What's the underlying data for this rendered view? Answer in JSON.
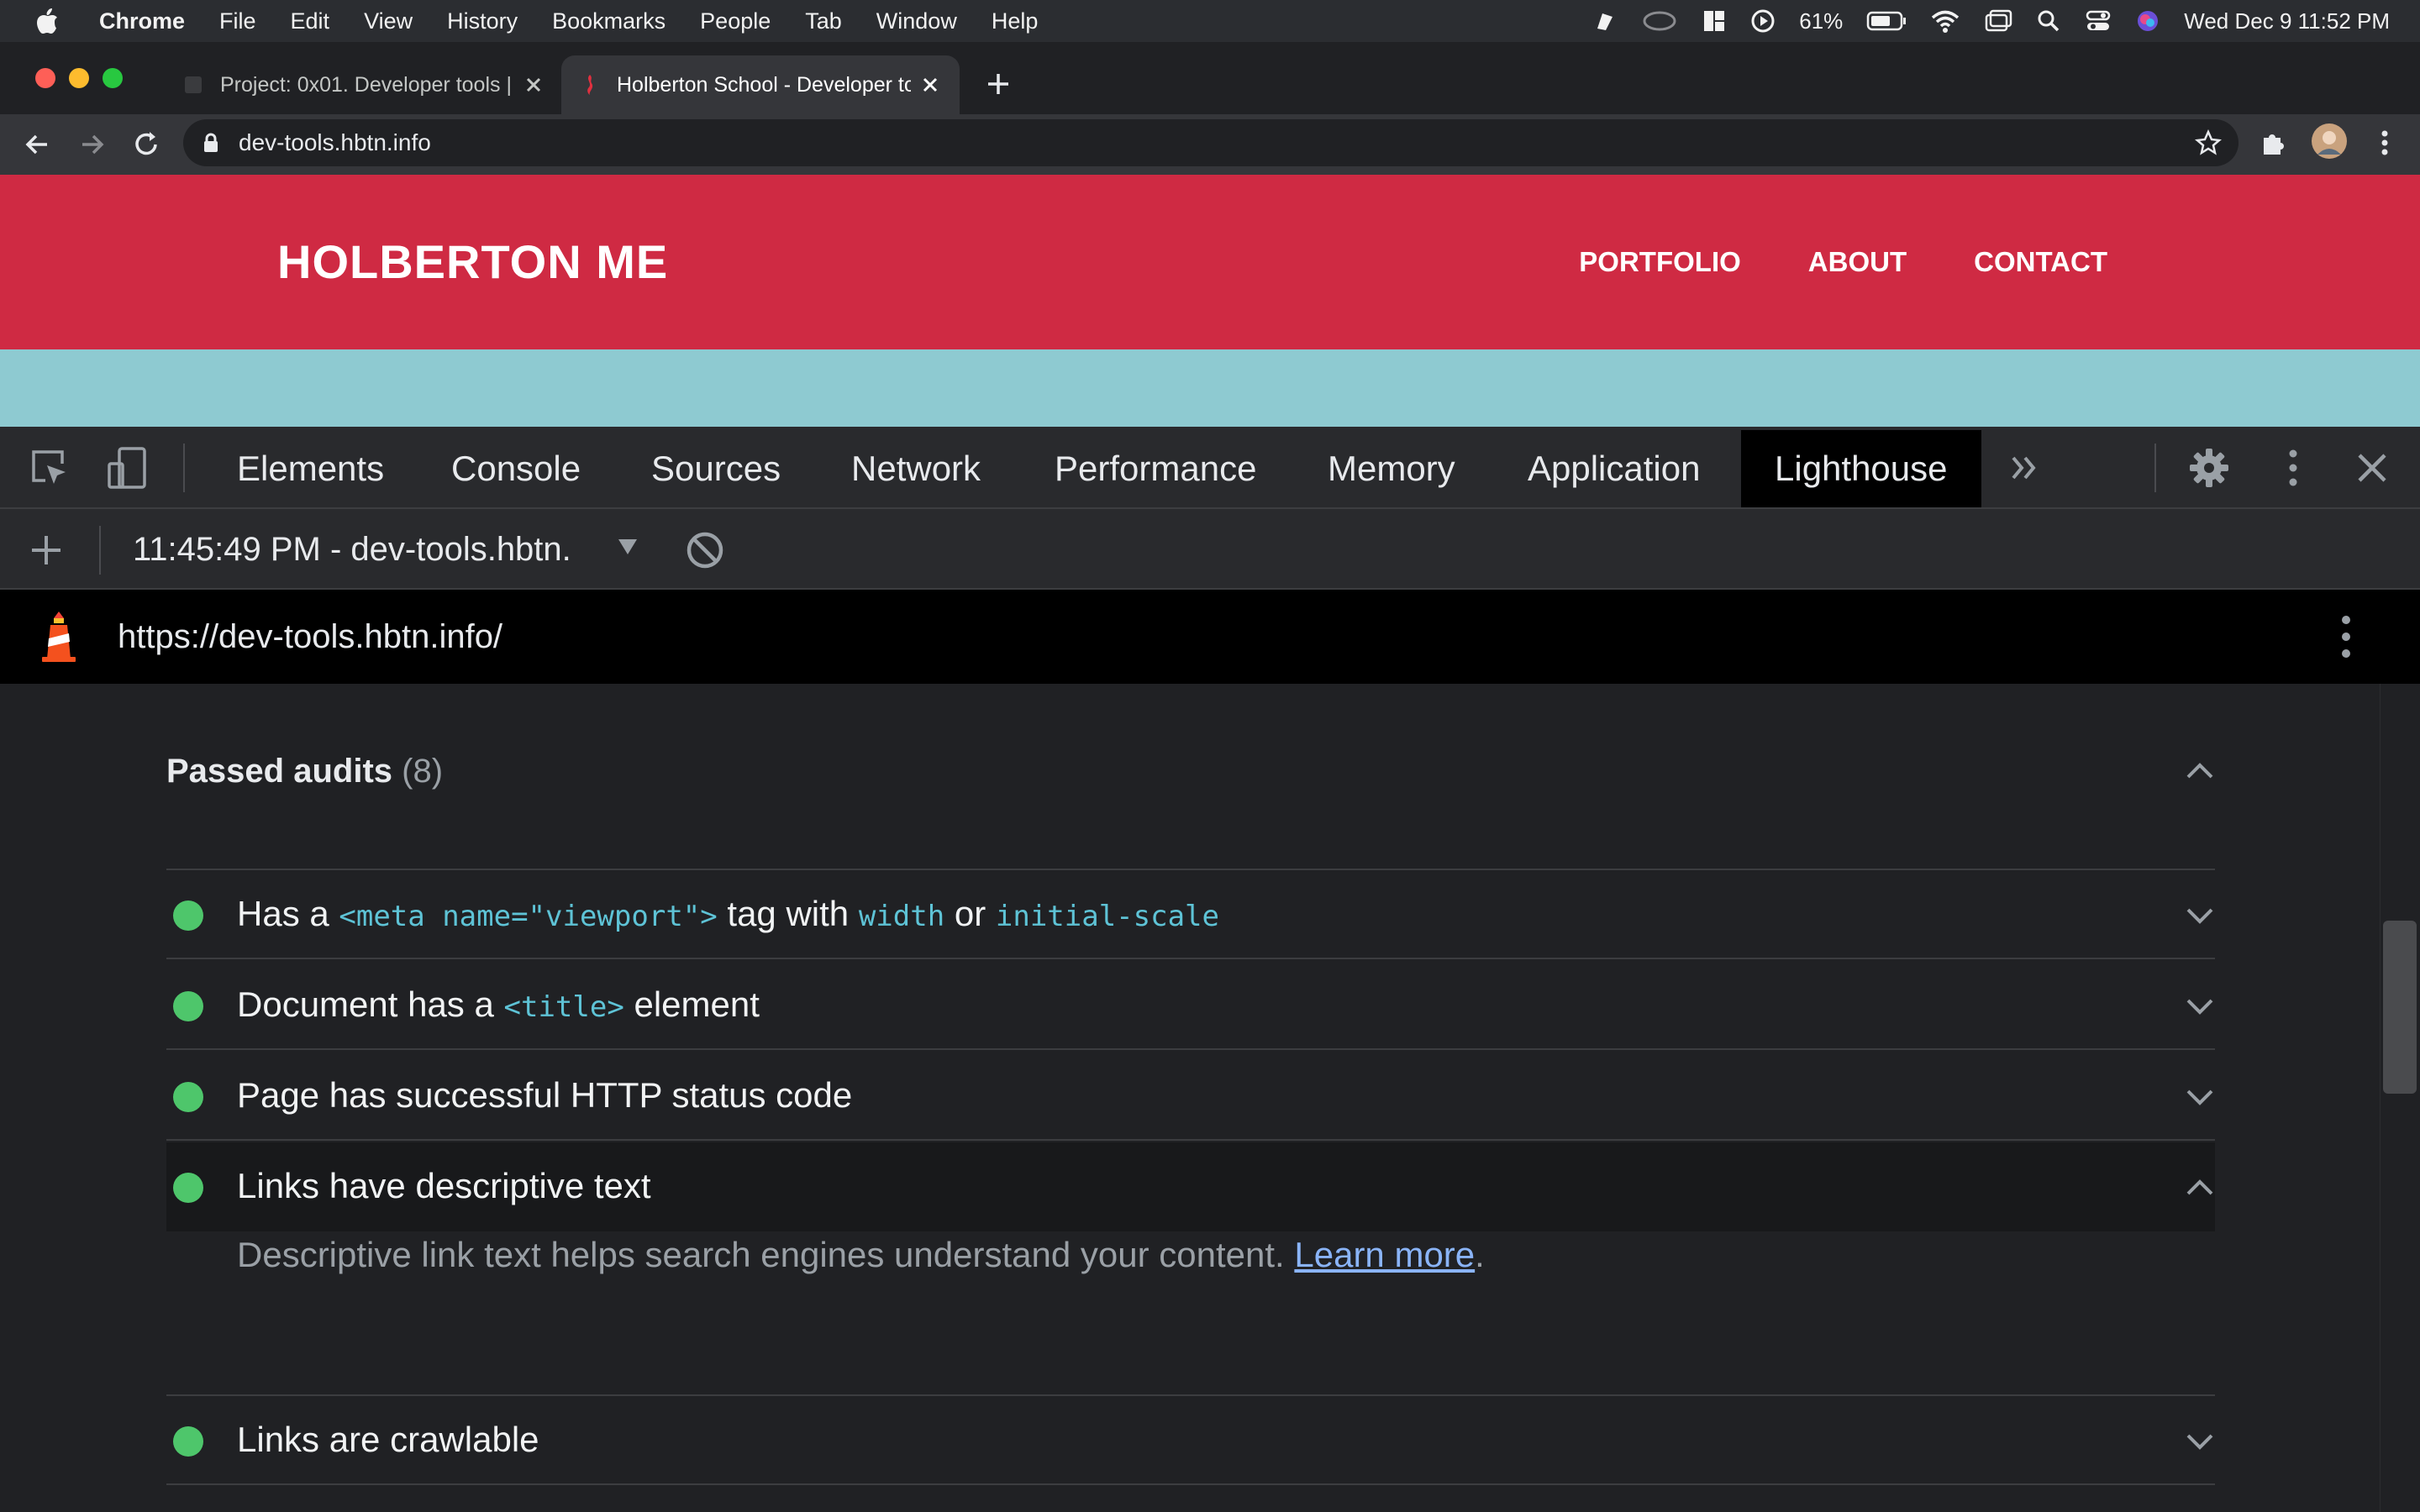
{
  "menubar": {
    "app_name": "Chrome",
    "items": [
      "File",
      "Edit",
      "View",
      "History",
      "Bookmarks",
      "People",
      "Tab",
      "Window",
      "Help"
    ],
    "battery": "61%",
    "datetime": "Wed Dec 9  11:52 PM"
  },
  "browser": {
    "tabs": [
      {
        "title": "Project: 0x01. Developer tools | I"
      },
      {
        "title": "Holberton School - Developer to"
      }
    ],
    "url": "dev-tools.hbtn.info"
  },
  "site": {
    "logo": "HOLBERTON ME",
    "nav": [
      "PORTFOLIO",
      "ABOUT",
      "CONTACT"
    ],
    "colors": {
      "header": "#cf2a43",
      "band": "#8ecad1"
    }
  },
  "devtools": {
    "tabs": [
      "Elements",
      "Console",
      "Sources",
      "Network",
      "Performance",
      "Memory",
      "Application",
      "Lighthouse"
    ],
    "active_tab": "Lighthouse",
    "report_select": "11:45:49 PM - dev-tools.hbtn.",
    "report_url": "https://dev-tools.hbtn.info/"
  },
  "report": {
    "group_title": "Passed audits",
    "group_count": "(8)",
    "audits": [
      {
        "status": "pass",
        "parts": [
          "Has a ",
          "<meta name=\"viewport\">",
          " tag with ",
          "width",
          " or ",
          "initial-scale"
        ]
      },
      {
        "status": "pass",
        "parts": [
          "Document has a ",
          "<title>",
          " element"
        ]
      },
      {
        "status": "pass",
        "text": "Page has successful HTTP status code"
      },
      {
        "status": "pass",
        "text": "Links have descriptive text",
        "expanded": true
      },
      {
        "status": "pass",
        "text": "Links are crawlable"
      }
    ],
    "expanded_description": "Descriptive link text helps search engines understand your content.",
    "learn_more": "Learn more",
    "period": ".",
    "pass_color": "#4ec66b"
  }
}
